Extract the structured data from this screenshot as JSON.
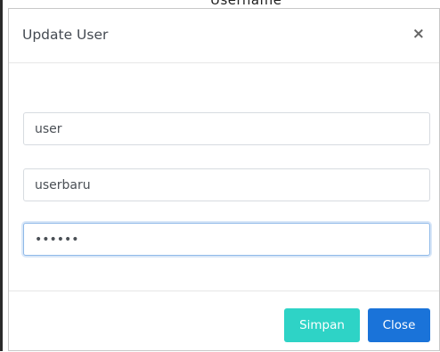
{
  "background": {
    "partial_text": "Username"
  },
  "modal": {
    "title": "Update User",
    "close_icon": "×",
    "fields": {
      "field1_value": "user",
      "field2_value": "userbaru",
      "field3_value": "••••••"
    },
    "buttons": {
      "save_label": "Simpan",
      "close_label": "Close"
    }
  },
  "colors": {
    "save_button": "#2ed3c6",
    "close_button": "#1a73d9",
    "focus_border": "#8fb9e8"
  }
}
